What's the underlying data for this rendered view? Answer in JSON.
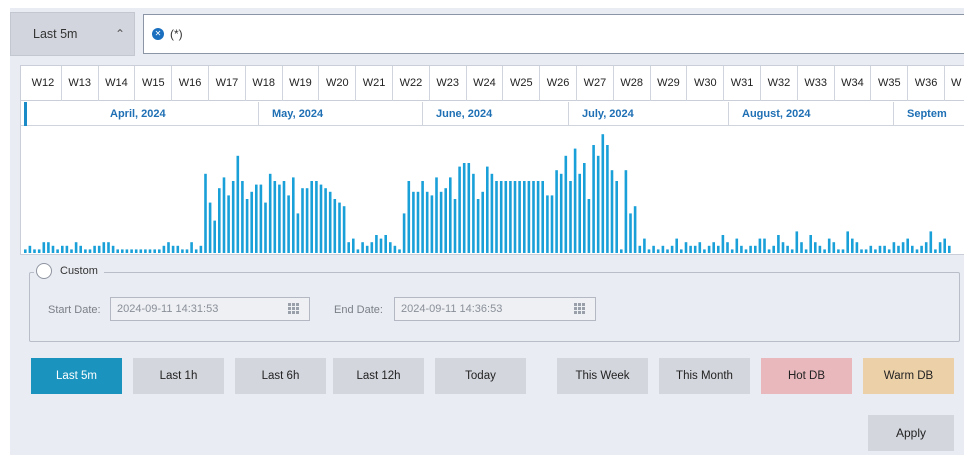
{
  "range_toggle": {
    "label": "Last 5m",
    "chevron": "chevron-up-icon"
  },
  "query": {
    "value": "(*)",
    "clear_icon": "clear-filter-icon"
  },
  "timeline": {
    "weeks": [
      "W12",
      "W13",
      "W14",
      "W15",
      "W16",
      "W17",
      "W18",
      "W19",
      "W20",
      "W21",
      "W22",
      "W23",
      "W24",
      "W25",
      "W26",
      "W27",
      "W28",
      "W29",
      "W30",
      "W31",
      "W32",
      "W33",
      "W34",
      "W35",
      "W36",
      "W"
    ],
    "months": [
      "April, 2024",
      "May, 2024",
      "June, 2024",
      "July, 2024",
      "August, 2024",
      "Septem"
    ],
    "bar_color": "#1aa0d8",
    "histogram_levels": [
      1,
      2,
      1,
      1,
      3,
      3,
      2,
      1,
      2,
      2,
      1,
      3,
      2,
      1,
      1,
      2,
      2,
      3,
      3,
      2,
      1,
      1,
      1,
      1,
      1,
      1,
      1,
      1,
      1,
      1,
      2,
      3,
      2,
      2,
      1,
      1,
      3,
      1,
      2,
      22,
      14,
      9,
      18,
      21,
      16,
      20,
      27,
      20,
      15,
      17,
      19,
      19,
      14,
      22,
      20,
      19,
      20,
      16,
      21,
      11,
      18,
      18,
      20,
      20,
      19,
      18,
      17,
      15,
      14,
      13,
      3,
      4,
      1,
      3,
      2,
      3,
      5,
      4,
      5,
      3,
      2,
      1,
      11,
      20,
      17,
      17,
      20,
      17,
      16,
      21,
      17,
      18,
      21,
      15,
      24,
      25,
      25,
      22,
      15,
      17,
      24,
      22,
      20,
      20,
      20,
      20,
      20,
      20,
      20,
      20,
      20,
      20,
      20,
      16,
      16,
      23,
      22,
      27,
      20,
      29,
      22,
      25,
      15,
      30,
      27,
      33,
      30,
      23,
      20,
      1,
      23,
      11,
      13,
      2,
      4,
      1,
      2,
      1,
      2,
      1,
      2,
      4,
      1,
      3,
      2,
      2,
      3,
      1,
      2,
      3,
      2,
      5,
      3,
      1,
      4,
      2,
      1,
      2,
      2,
      4,
      4,
      1,
      2,
      5,
      3,
      2,
      1,
      6,
      3,
      1,
      5,
      3,
      2,
      1,
      4,
      3,
      1,
      1,
      6,
      4,
      3,
      1,
      1,
      2,
      1,
      2,
      2,
      1,
      3,
      2,
      3,
      4,
      2,
      1,
      2,
      3,
      6,
      1,
      3,
      4,
      2
    ]
  },
  "custom": {
    "label": "Custom",
    "start_label": "Start Date:",
    "start_value": "2024-09-11 14:31:53",
    "end_label": "End Date:",
    "end_value": "2024-09-11 14:36:53"
  },
  "quick_buttons": [
    {
      "label": "Last 5m",
      "bg": "#1a94bf",
      "fg": "#ffffff"
    },
    {
      "label": "Last 1h",
      "bg": "#d3d6dd",
      "fg": "#222222"
    },
    {
      "label": "Last 6h",
      "bg": "#d3d6dd",
      "fg": "#222222"
    },
    {
      "label": "Last 12h",
      "bg": "#d3d6dd",
      "fg": "#222222"
    },
    {
      "label": "Today",
      "bg": "#d3d6dd",
      "fg": "#222222"
    },
    {
      "label": "This Week",
      "bg": "#d3d6dd",
      "fg": "#222222"
    },
    {
      "label": "This Month",
      "bg": "#d3d6dd",
      "fg": "#222222"
    },
    {
      "label": "Hot DB",
      "bg": "#e8b8bc",
      "fg": "#222222"
    },
    {
      "label": "Warm DB",
      "bg": "#ecd0a8",
      "fg": "#222222"
    }
  ],
  "apply_label": "Apply"
}
